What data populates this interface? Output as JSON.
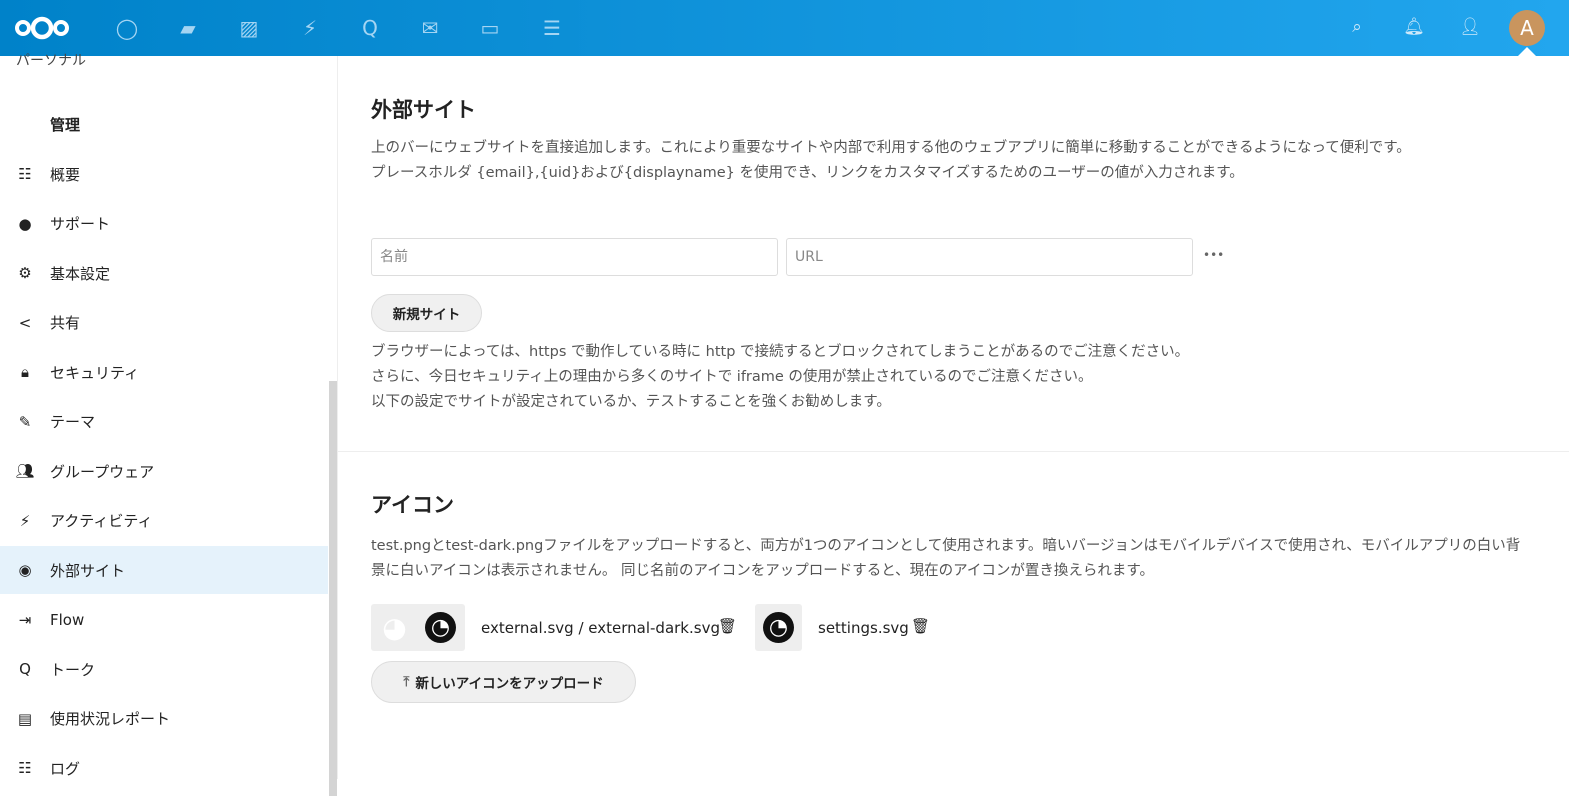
{
  "topbar": {
    "apps": [
      "dashboard-icon",
      "files-icon",
      "photos-icon",
      "activity-icon",
      "talk-icon",
      "mail-icon",
      "calendar-icon",
      "tasks-icon"
    ],
    "avatar_initial": "A",
    "colors": {
      "start": "#0082c9",
      "end": "#22a6ee"
    }
  },
  "sidebar": {
    "top_partial": "パーソナル",
    "heading": "管理",
    "items": [
      {
        "label": "概要",
        "icon": "list-icon"
      },
      {
        "label": "サポート",
        "icon": "speech-bubble-icon"
      },
      {
        "label": "基本設定",
        "icon": "gear-icon"
      },
      {
        "label": "共有",
        "icon": "share-icon"
      },
      {
        "label": "セキュリティ",
        "icon": "lock-icon"
      },
      {
        "label": "テーマ",
        "icon": "brush-icon"
      },
      {
        "label": "グループウェア",
        "icon": "contacts-icon"
      },
      {
        "label": "アクティビティ",
        "icon": "lightning-icon"
      },
      {
        "label": "外部サイト",
        "icon": "globe-icon",
        "active": true
      },
      {
        "label": "Flow",
        "icon": "flow-icon"
      },
      {
        "label": "トーク",
        "icon": "talk-icon"
      },
      {
        "label": "使用状況レポート",
        "icon": "report-icon"
      },
      {
        "label": "ログ",
        "icon": "list-icon"
      }
    ]
  },
  "external": {
    "title": "外部サイト",
    "desc1": "上のバーにウェブサイトを直接追加します。これにより重要なサイトや内部で利用する他のウェブアプリに簡単に移動することができるようになって便利です。",
    "desc2": "プレースホルダ {email},{uid}および{displayname} を使用でき、リンクをカスタマイズするためのユーザーの値が入力されます。",
    "name_placeholder": "名前",
    "url_placeholder": "URL",
    "more": "•••",
    "new_site": "新規サイト",
    "warn1": "ブラウザーによっては、https で動作している時に http で接続するとブロックされてしまうことがあるのでご注意ください。",
    "warn2": "さらに、今日セキュリティ上の理由から多くのサイトで iframe の使用が禁止されているのでご注意ください。",
    "warn3": "以下の設定でサイトが設定されているか、テストすることを強くお勧めします。"
  },
  "icons": {
    "title": "アイコン",
    "desc": "test.pngとtest-dark.pngファイルをアップロードすると、両方が1つのアイコンとして使用されます。暗いバージョンはモバイルデバイスで使用され、モバイルアプリの白い背景に白いアイコンは表示されません。 同じ名前のアイコンをアップロードすると、現在のアイコンが置き換えられます。",
    "file1": "external.svg / external-dark.svg",
    "file2": "settings.svg",
    "upload": "新しいアイコンをアップロード"
  }
}
